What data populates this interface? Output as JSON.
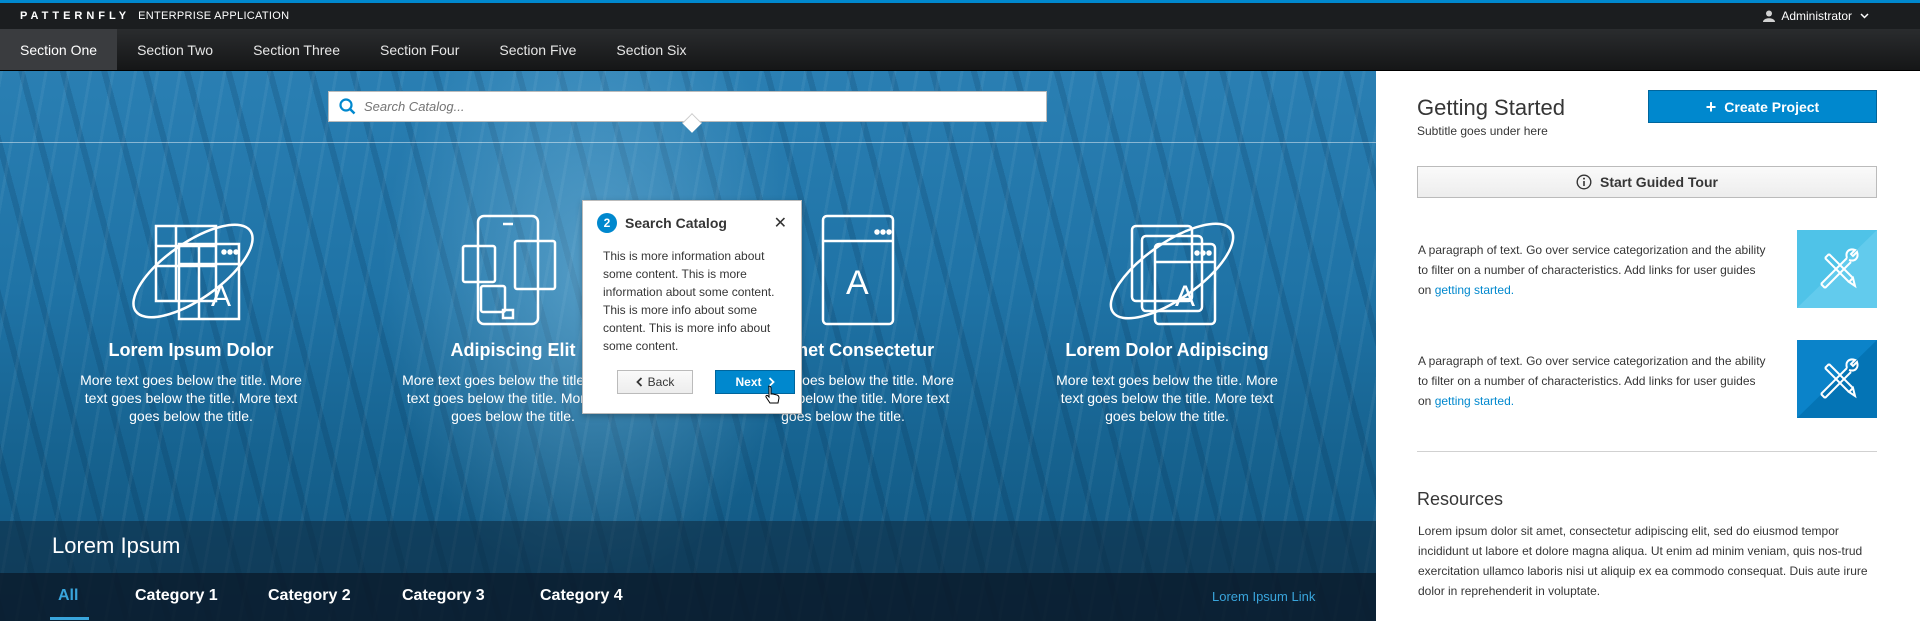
{
  "masthead": {
    "brand": "PATTERNFLY",
    "brand_sub": "ENTERPRISE APPLICATION",
    "user": "Administrator"
  },
  "nav": [
    "Section One",
    "Section Two",
    "Section Three",
    "Section Four",
    "Section Five",
    "Section Six"
  ],
  "search": {
    "placeholder": "Search Catalog..."
  },
  "cards": [
    {
      "title": "Lorem Ipsum Dolor",
      "text": "More text goes below the title. More text goes below the title. More text goes below the title.",
      "icon": "grid-orbit-icon"
    },
    {
      "title": "Adipiscing Elit",
      "text": "More text goes below the title. More text goes below the title. More text goes below the title.",
      "icon": "devices-icon"
    },
    {
      "title": "Sit Amet Consectetur",
      "text": "More text goes below the title. More text goes below the title. More text goes below the title.",
      "icon": "app-window-icon"
    },
    {
      "title": "Lorem Dolor Adipiscing",
      "text": "More text goes below the title. More text goes below the title. More text goes below the title.",
      "icon": "layers-orbit-icon"
    }
  ],
  "lower": {
    "title": "Lorem Ipsum"
  },
  "tabs": {
    "items": [
      "All",
      "Category 1",
      "Category 2",
      "Category 3",
      "Category 4"
    ],
    "active": "All",
    "link": "Lorem Ipsum Link"
  },
  "popover": {
    "step": "2",
    "title": "Search Catalog",
    "body": "This is more information about some content. This is more information about some content. This is more info about some content. This is more info about some content.",
    "back": "Back",
    "next": "Next"
  },
  "panel": {
    "title": "Getting Started",
    "subtitle": "Subtitle goes under here",
    "create_label": "Create Project",
    "tour_label": "Start Guided Tour",
    "paragraphs": [
      {
        "text": "A paragraph of text. Go over service categorization and the ability to filter on a number of characteristics. Add links for user guides on ",
        "link": "getting started."
      },
      {
        "text": "A paragraph of text. Go over service categorization and the ability to filter on a number of characteristics. Add links for user guides on ",
        "link": "getting started."
      }
    ],
    "resources_title": "Resources",
    "resources_text": "Lorem ipsum dolor sit amet, consectetur adipiscing elit, sed do eiusmod tempor incididunt ut labore et dolore magna aliqua. Ut enim ad minim veniam, quis nos-trud exercitation ullamco laboris nisi ut aliquip ex ea commodo consequat. Duis aute irure dolor in reprehenderit in voluptate."
  },
  "colors": {
    "accent": "#0088ce",
    "masthead": "#1b1d1f",
    "tab_active": "#39a5dc",
    "tile_light": "#4fc3e8",
    "tile_dark": "#0b83c9"
  }
}
